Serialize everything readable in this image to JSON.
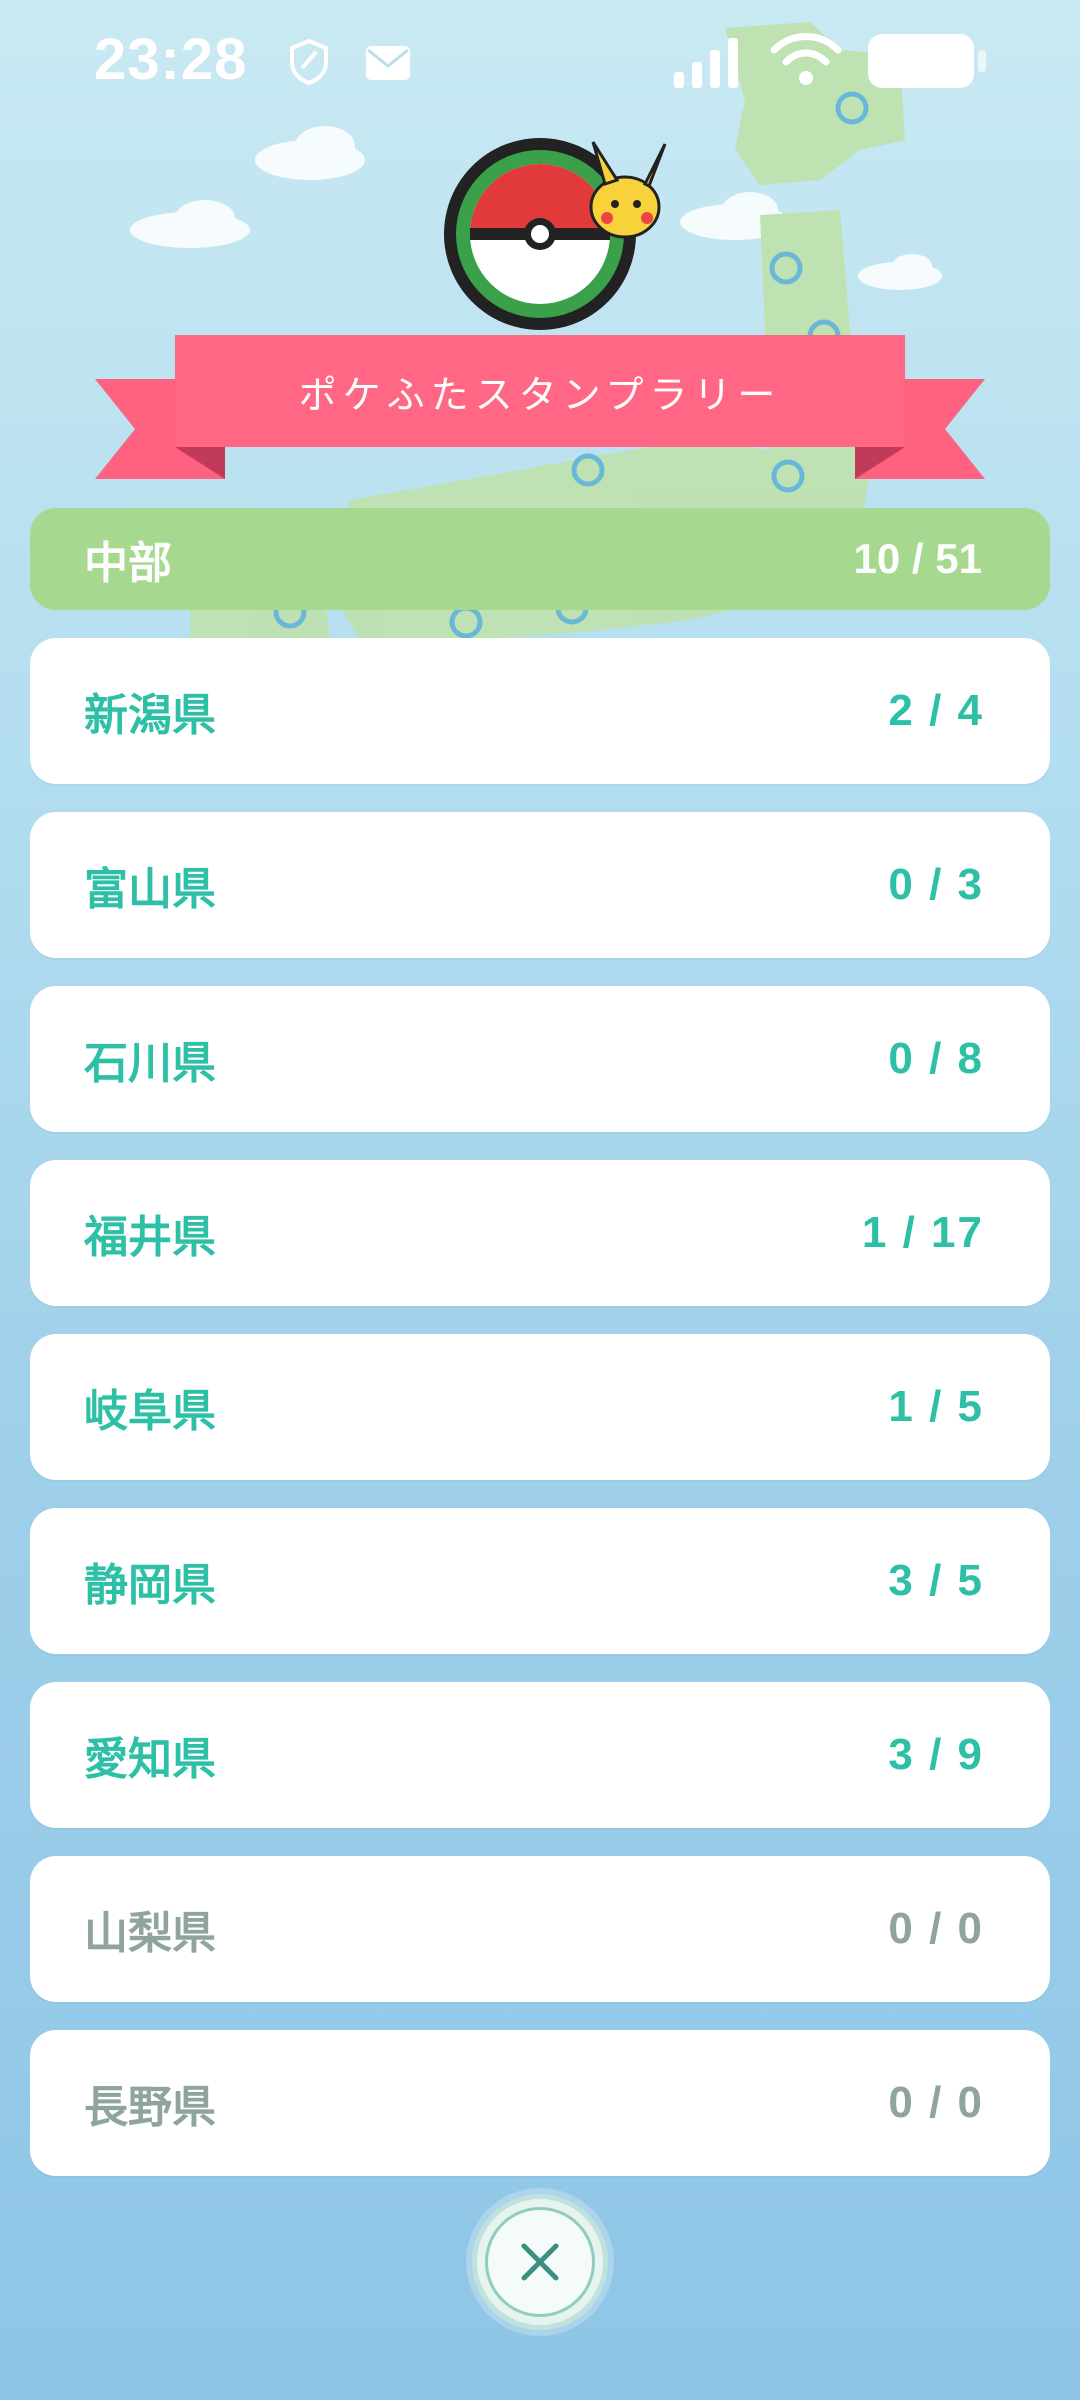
{
  "status_bar": {
    "time": "23:28",
    "icons": [
      "shield-icon",
      "mail-icon",
      "signal-icon",
      "wifi-icon",
      "battery-icon"
    ]
  },
  "header": {
    "logo_icon": "pokefuta-manhole-logo-icon",
    "title": "ポケふたスタンプラリー"
  },
  "region": {
    "name": "中部",
    "count": "10 / 51"
  },
  "prefectures": [
    {
      "name": "新潟県",
      "count": "2 / 4",
      "active": true
    },
    {
      "name": "富山県",
      "count": "0 / 3",
      "active": true
    },
    {
      "name": "石川県",
      "count": "0 / 8",
      "active": true
    },
    {
      "name": "福井県",
      "count": "1 / 17",
      "active": true
    },
    {
      "name": "岐阜県",
      "count": "1 / 5",
      "active": true
    },
    {
      "name": "静岡県",
      "count": "3 / 5",
      "active": true
    },
    {
      "name": "愛知県",
      "count": "3 / 9",
      "active": true
    },
    {
      "name": "山梨県",
      "count": "0 / 0",
      "active": false
    },
    {
      "name": "長野県",
      "count": "0 / 0",
      "active": false
    }
  ],
  "close_icon": "close-icon",
  "colors": {
    "accent_teal": "#2ec0a6",
    "inactive_gray": "#8fa39f",
    "region_green": "#a6d98f",
    "ribbon_pink": "#ff6280"
  }
}
